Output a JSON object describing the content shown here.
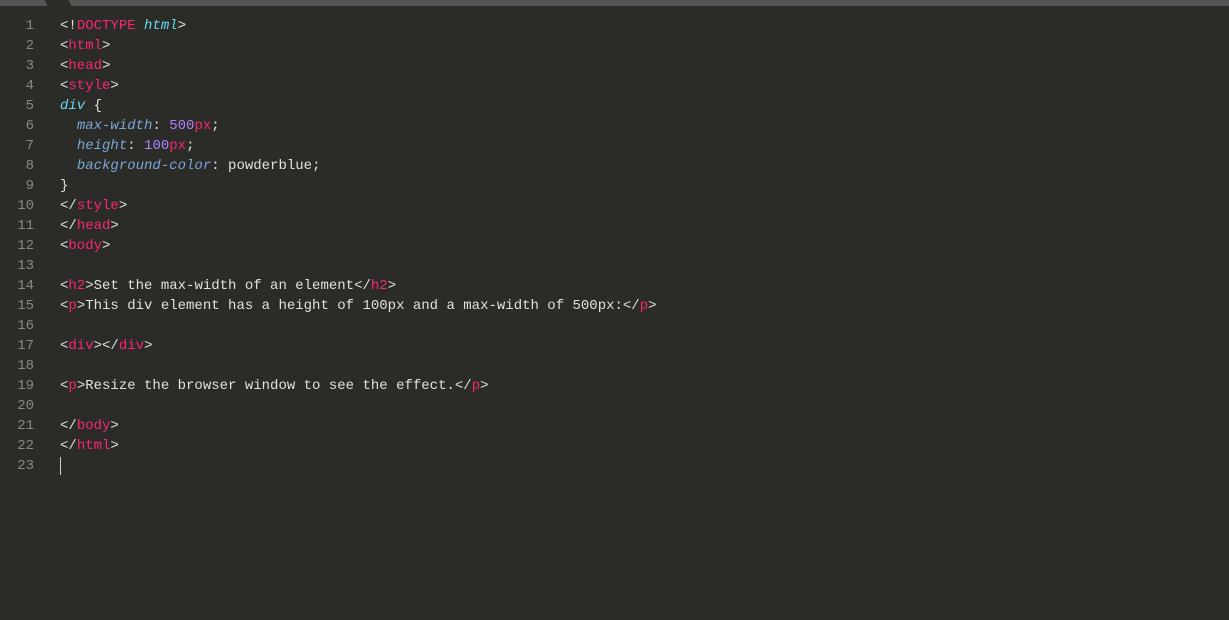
{
  "gutter": [
    "1",
    "2",
    "3",
    "4",
    "5",
    "6",
    "7",
    "8",
    "9",
    "10",
    "11",
    "12",
    "13",
    "14",
    "15",
    "16",
    "17",
    "18",
    "19",
    "20",
    "21",
    "22",
    "23"
  ],
  "code": {
    "l1": {
      "a": "<!",
      "b": "DOCTYPE",
      "c": " ",
      "d": "html",
      "e": ">"
    },
    "l2": {
      "a": "<",
      "b": "html",
      "c": ">"
    },
    "l3": {
      "a": "<",
      "b": "head",
      "c": ">"
    },
    "l4": {
      "a": "<",
      "b": "style",
      "c": ">"
    },
    "l5": {
      "a": "div",
      "b": " {"
    },
    "l6": {
      "a": "  ",
      "b": "max-width",
      "c": ": ",
      "d": "500",
      "e": "px",
      "f": ";"
    },
    "l7": {
      "a": "  ",
      "b": "height",
      "c": ": ",
      "d": "100",
      "e": "px",
      "f": ";"
    },
    "l8": {
      "a": "  ",
      "b": "background-color",
      "c": ": ",
      "d": "powderblue",
      "e": ";"
    },
    "l9": {
      "a": "}"
    },
    "l10": {
      "a": "</",
      "b": "style",
      "c": ">"
    },
    "l11": {
      "a": "</",
      "b": "head",
      "c": ">"
    },
    "l12": {
      "a": "<",
      "b": "body",
      "c": ">"
    },
    "l13": {
      "a": ""
    },
    "l14": {
      "a": "<",
      "b": "h2",
      "c": ">",
      "d": "Set the max-width of an element",
      "e": "</",
      "f": "h2",
      "g": ">"
    },
    "l15": {
      "a": "<",
      "b": "p",
      "c": ">",
      "d": "This div element has a height of 100px and a max-width of 500px:",
      "e": "</",
      "f": "p",
      "g": ">"
    },
    "l16": {
      "a": ""
    },
    "l17": {
      "a": "<",
      "b": "div",
      "c": ">",
      "d": "</",
      "e": "div",
      "f": ">"
    },
    "l18": {
      "a": ""
    },
    "l19": {
      "a": "<",
      "b": "p",
      "c": ">",
      "d": "Resize the browser window to see the effect.",
      "e": "</",
      "f": "p",
      "g": ">"
    },
    "l20": {
      "a": ""
    },
    "l21": {
      "a": "</",
      "b": "body",
      "c": ">"
    },
    "l22": {
      "a": "</",
      "b": "html",
      "c": ">"
    },
    "l23": {
      "a": ""
    }
  }
}
